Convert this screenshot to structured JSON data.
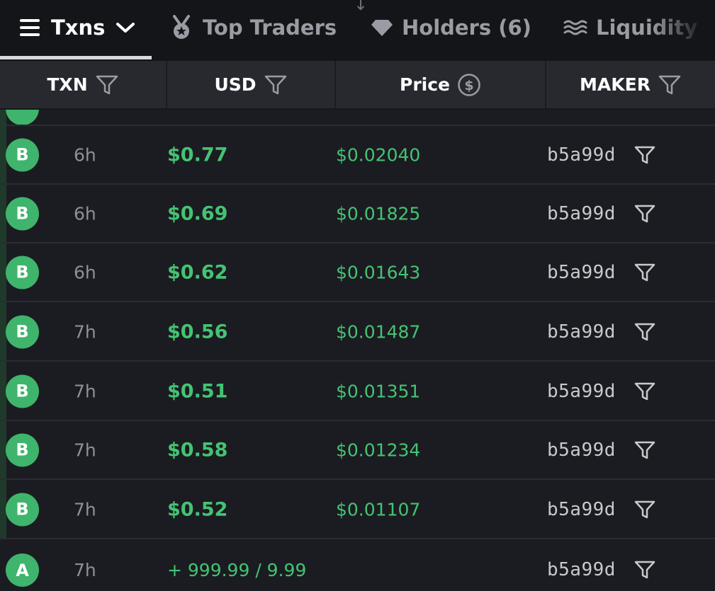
{
  "tabs": [
    {
      "label": "Txns",
      "active": true,
      "icon": "menu-icon",
      "trailing_icon": "chevron-down-icon"
    },
    {
      "label": "Top Traders",
      "active": false,
      "icon": "medal-icon"
    },
    {
      "label": "Holders (6)",
      "active": false,
      "icon": "diamond-icon"
    },
    {
      "label": "Liquidity Pr",
      "active": false,
      "icon": "waves-icon"
    }
  ],
  "header": {
    "txn": "TXN",
    "usd": "USD",
    "price": "Price",
    "maker": "MAKER"
  },
  "colors": {
    "buy_green": "#3fb46c",
    "value_green": "#44c373",
    "background": "#1b1c21",
    "header_bg": "#27292e"
  },
  "rows": [
    {
      "type": "B",
      "age": "6h",
      "usd": "$0.77",
      "price": "$0.02040",
      "maker": "b5a99d"
    },
    {
      "type": "B",
      "age": "6h",
      "usd": "$0.69",
      "price": "$0.01825",
      "maker": "b5a99d"
    },
    {
      "type": "B",
      "age": "6h",
      "usd": "$0.62",
      "price": "$0.01643",
      "maker": "b5a99d"
    },
    {
      "type": "B",
      "age": "7h",
      "usd": "$0.56",
      "price": "$0.01487",
      "maker": "b5a99d"
    },
    {
      "type": "B",
      "age": "7h",
      "usd": "$0.51",
      "price": "$0.01351",
      "maker": "b5a99d"
    },
    {
      "type": "B",
      "age": "7h",
      "usd": "$0.58",
      "price": "$0.01234",
      "maker": "b5a99d"
    },
    {
      "type": "B",
      "age": "7h",
      "usd": "$0.52",
      "price": "$0.01107",
      "maker": "b5a99d"
    },
    {
      "type": "A",
      "age": "7h",
      "usd": "+ 999.99 / 9.99",
      "price": "",
      "maker": "b5a99d"
    }
  ]
}
